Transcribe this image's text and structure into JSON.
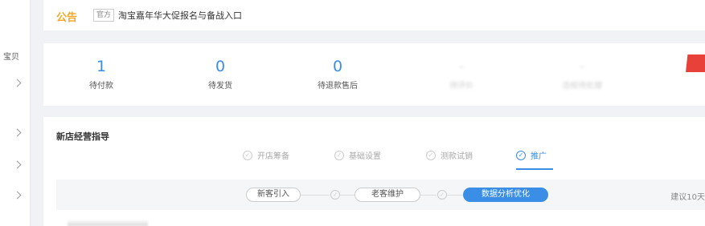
{
  "sidebar": {
    "fragments": [
      "宝贝",
      "",
      "",
      "",
      ""
    ]
  },
  "notice": {
    "title": "公告",
    "tag": "官方",
    "text": "淘宝嘉年华大促报名与备战入口"
  },
  "stats": [
    {
      "value": "1",
      "label": "待付款"
    },
    {
      "value": "0",
      "label": "待发货"
    },
    {
      "value": "0",
      "label": "待退款售后"
    },
    {
      "value": "-",
      "label": "待评价"
    },
    {
      "value": "-",
      "label": "违规待处理"
    }
  ],
  "guide": {
    "title": "新店经营指导",
    "steps": [
      {
        "label": "开店筹备",
        "active": false
      },
      {
        "label": "基础设置",
        "active": false
      },
      {
        "label": "测款试销",
        "active": false
      },
      {
        "label": "推广",
        "active": true
      }
    ],
    "sub_steps": [
      {
        "label": "新客引入",
        "active": false
      },
      {
        "label": "老客维护",
        "active": false
      },
      {
        "label": "数据分析优化",
        "active": true
      }
    ],
    "suggest": "建议10天"
  },
  "colors": {
    "accent": "#3a8ee6",
    "notice": "#f5a623",
    "flag": "#e8413a"
  }
}
